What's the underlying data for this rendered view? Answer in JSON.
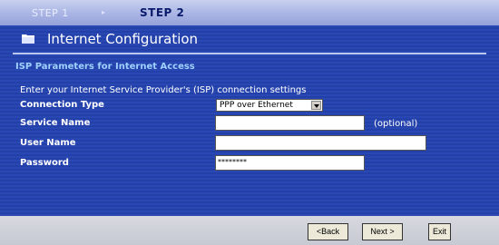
{
  "steps": {
    "step1": "STEP 1",
    "step2": "STEP 2"
  },
  "page": {
    "title": "Internet Configuration"
  },
  "section": {
    "title": "ISP Parameters for Internet Access",
    "description": "Enter your Internet Service Provider's (ISP) connection settings"
  },
  "form": {
    "connection_type": {
      "label": "Connection Type",
      "value": "PPP over Ethernet"
    },
    "service_name": {
      "label": "Service Name",
      "value": "",
      "note": "(optional)"
    },
    "user_name": {
      "label": "User Name",
      "value": ""
    },
    "password": {
      "label": "Password",
      "value": "********"
    }
  },
  "buttons": {
    "back": "<Back",
    "next": "Next >",
    "exit": "Exit"
  }
}
